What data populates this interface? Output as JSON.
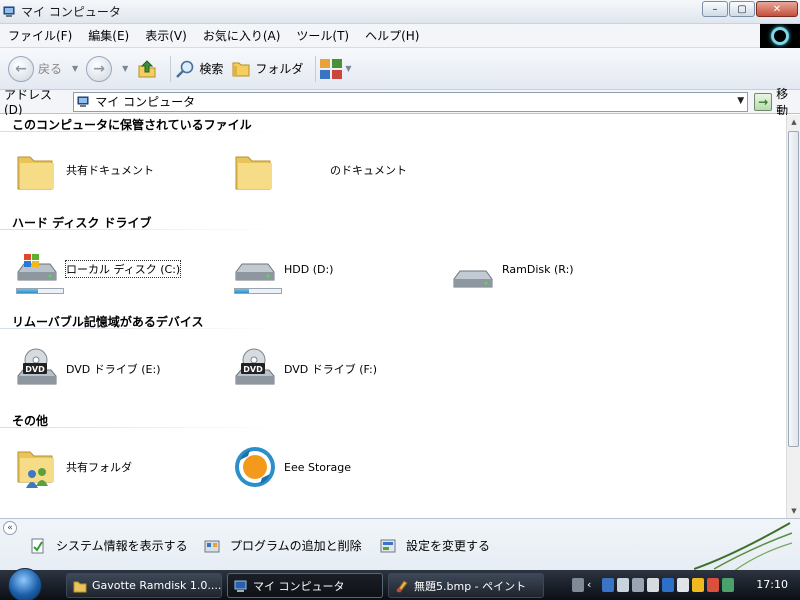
{
  "window": {
    "title": "マイ コンピュータ",
    "controls": {
      "minimize": "–",
      "maximize": "▢",
      "close": "✕"
    }
  },
  "menu": [
    "ファイル(F)",
    "編集(E)",
    "表示(V)",
    "お気に入り(A)",
    "ツール(T)",
    "ヘルプ(H)"
  ],
  "toolbar": {
    "back_label": "戻る",
    "search_label": "検索",
    "folders_label": "フォルダ"
  },
  "address": {
    "label": "アドレス(D)",
    "value": "マイ コンピュータ",
    "go_label": "移動"
  },
  "groups": [
    {
      "title": "このコンピュータに保管されているファイル",
      "items": [
        {
          "label": "共有ドキュメント",
          "icon": "folder-icon"
        },
        {
          "label": "のドキュメント",
          "icon": "folder-icon"
        }
      ]
    },
    {
      "title": "ハード ディスク ドライブ",
      "items": [
        {
          "label": "ローカル ディスク (C:)",
          "icon": "windows-drive-icon",
          "usage": 0.45
        },
        {
          "label": "HDD (D:)",
          "icon": "hard-drive-icon",
          "usage": 0.3
        },
        {
          "label": "RamDisk (R:)",
          "icon": "hard-drive-icon"
        }
      ]
    },
    {
      "title": "リムーバブル記憶域があるデバイス",
      "items": [
        {
          "label": "DVD ドライブ (E:)",
          "icon": "dvd-drive-icon"
        },
        {
          "label": "DVD ドライブ (F:)",
          "icon": "dvd-drive-icon"
        }
      ]
    },
    {
      "title": "その他",
      "items": [
        {
          "label": "共有フォルダ",
          "icon": "shared-folder-icon"
        },
        {
          "label": "Eee Storage",
          "icon": "eee-storage-icon"
        }
      ]
    }
  ],
  "tasks": [
    {
      "label": "システム情報を表示する",
      "icon": "system-info-icon"
    },
    {
      "label": "プログラムの追加と削除",
      "icon": "add-remove-programs-icon"
    },
    {
      "label": "設定を変更する",
      "icon": "control-panel-icon"
    }
  ],
  "taskbar": {
    "buttons": [
      {
        "label": "Gavotte Ramdisk 1.0....",
        "icon": "folder-icon"
      },
      {
        "label": "マイ コンピュータ",
        "icon": "computer-icon",
        "active": true
      },
      {
        "label": "無題5.bmp - ペイント",
        "icon": "paint-icon"
      }
    ],
    "clock": "17:10"
  },
  "colors": {
    "accent": "#2b8fcc",
    "taskbar": "#0b0f15",
    "eee_orange": "#f39a1c"
  }
}
